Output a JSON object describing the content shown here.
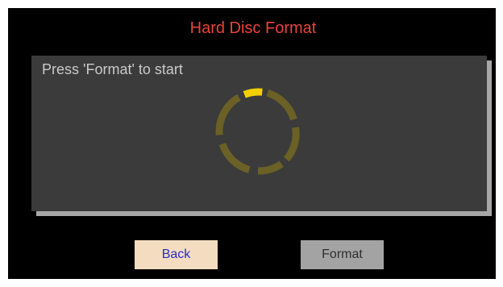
{
  "dialog": {
    "title": "Hard Disc Format",
    "status_text": "Press 'Format' to start",
    "spinner_icon": "loading-spinner-icon",
    "colors": {
      "title": "#e8443a",
      "panel": "#3b3b3b",
      "spinner_active": "#f2d000",
      "spinner_inactive": "#6b6025"
    }
  },
  "buttons": {
    "back_label": "Back",
    "format_label": "Format"
  }
}
